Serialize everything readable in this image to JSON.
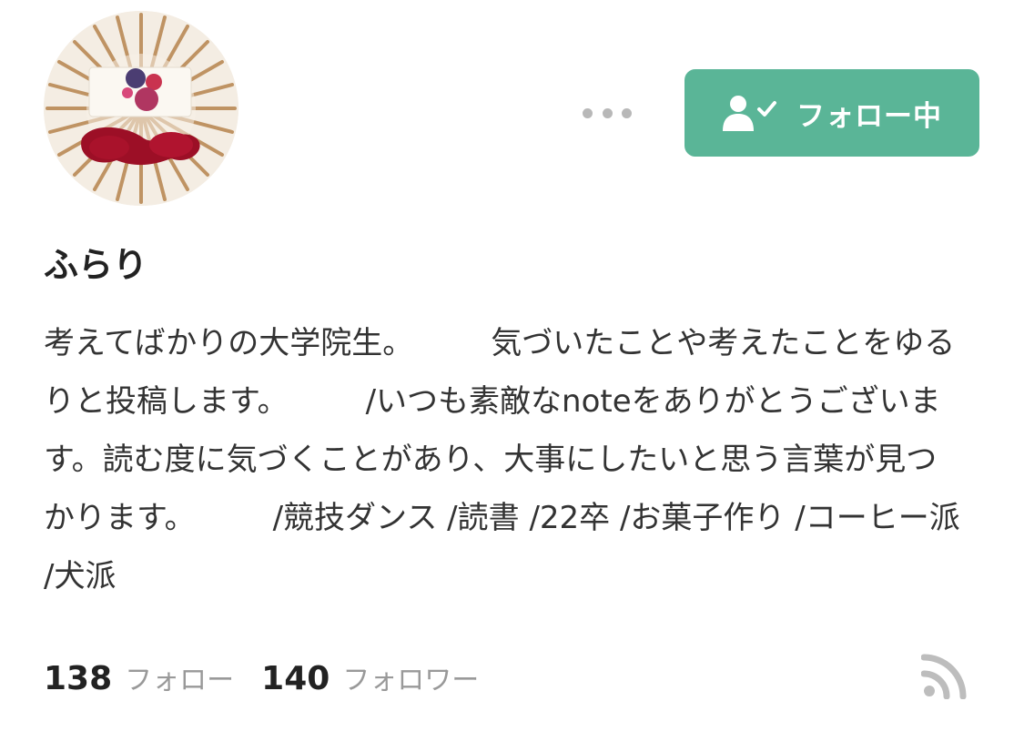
{
  "profile": {
    "name": "ふらり",
    "bio": "考えてばかりの大学院生。　　　気づいたことや考えたことをゆるりと投稿します。　　　/いつも素敵なnoteをありがとうございます。読む度に気づくことがあり、大事にしたいと思う言葉が見つかります。　　　/競技ダンス /読書 /22卒 /お菓子作り /コーヒー派 /犬派"
  },
  "actions": {
    "more_icon": "ellipsis-icon",
    "follow_icon": "user-check-icon",
    "follow_label": "フォロー中"
  },
  "stats": {
    "following_count": "138",
    "following_label": "フォロー",
    "followers_count": "140",
    "followers_label": "フォロワー"
  },
  "icons": {
    "rss": "rss-icon"
  },
  "colors": {
    "accent": "#5ab597",
    "muted": "#999999",
    "icon_gray": "#b8b8b8"
  }
}
